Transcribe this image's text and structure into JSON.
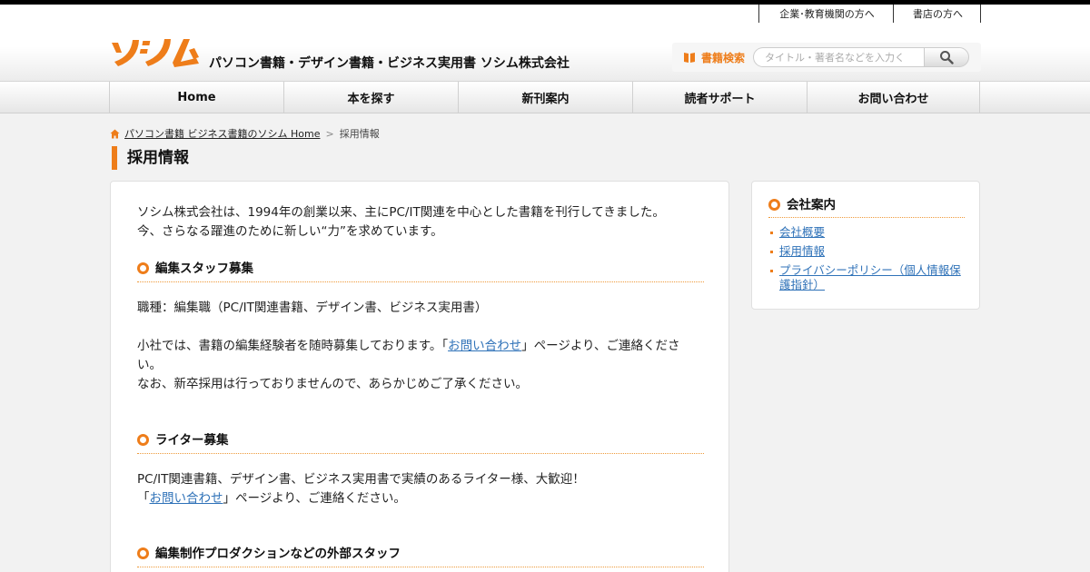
{
  "header": {
    "util_links": [
      "企業･教育機関の方へ",
      "書店の方へ"
    ],
    "logo_text": "ソシム",
    "tagline": "パソコン書籍・デザイン書籍・ビジネス実用書 ソシム株式会社",
    "search": {
      "label": "書籍検索",
      "placeholder": "タイトル・著者名などを入力く",
      "icon": "search-icon"
    }
  },
  "nav": {
    "items": [
      "Home",
      "本を探す",
      "新刊案内",
      "読者サポート",
      "お問い合わせ"
    ]
  },
  "breadcrumb": {
    "home": "パソコン書籍 ビジネス書籍のソシム Home",
    "separator": ">",
    "current": "採用情報"
  },
  "page_title": "採用情報",
  "main": {
    "intro": [
      "ソシム株式会社は、1994年の創業以来、主にPC/IT関連を中心とした書籍を刊行してきました。",
      "今、さらなる躍進のために新しい“力”を求めています。"
    ],
    "sections": [
      {
        "title": "編集スタッフ募集",
        "job": "職種：編集職（PC/IT関連書籍、デザイン書、ビジネス実用書）",
        "pre": "小社では、書籍の編集経験者を随時募集しております。「",
        "link": "お問い合わせ",
        "post": "」ページより、ご連絡ください。",
        "note": "なお、新卒採用は行っておりませんので、あらかじめご了承ください。"
      },
      {
        "title": "ライター募集",
        "line1": "PC/IT関連書籍、デザイン書、ビジネス実用書で実績のあるライター様、大歓迎！",
        "pre": "「",
        "link": "お問い合わせ",
        "post": "」ページより、ご連絡ください。"
      },
      {
        "title": "編集制作プロダクションなどの外部スタッフ"
      }
    ]
  },
  "sidebar": {
    "title": "会社案内",
    "items": [
      "会社概要",
      "採用情報",
      "プライバシーポリシー（個人情報保護指針）"
    ]
  },
  "colors": {
    "accent": "#ee7d1a",
    "link": "#2f72b8"
  }
}
